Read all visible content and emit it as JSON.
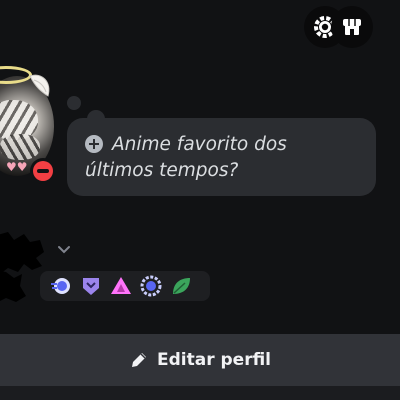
{
  "header": {
    "nitro_icon": "nitro-gear-icon",
    "shop_icon": "shop-icon"
  },
  "status": {
    "text": "Anime favorito dos últimos tempos?",
    "icon": "plus-circle-icon"
  },
  "badges": [
    {
      "name": "hypesquad-badge",
      "color": "#5865f2"
    },
    {
      "name": "nitro-tier-badge",
      "color": "#9b84ec"
    },
    {
      "name": "boost-badge",
      "color": "#ff73fa"
    },
    {
      "name": "quest-badge",
      "color": "#c9cdfb"
    },
    {
      "name": "leaf-badge",
      "color": "#3ba55c"
    }
  ],
  "actions": {
    "edit_profile_label": "Editar perfil",
    "edit_icon": "pencil-icon"
  },
  "presence": {
    "status": "do-not-disturb",
    "color": "#f23f43"
  }
}
